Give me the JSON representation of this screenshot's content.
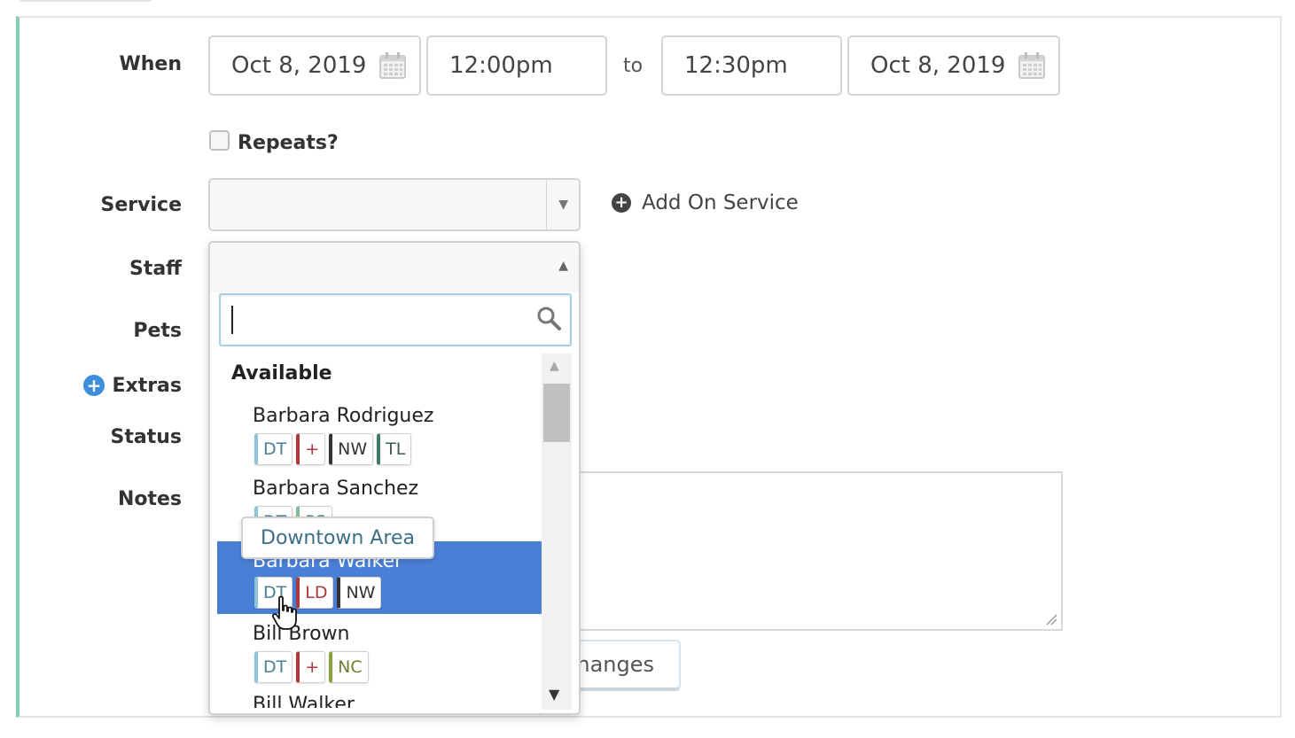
{
  "form": {
    "when_label": "When",
    "start_date": "Oct 8, 2019",
    "start_time": "12:00pm",
    "to_label": "to",
    "end_time": "12:30pm",
    "end_date": "Oct 8, 2019",
    "repeats_label": "Repeats?",
    "service_label": "Service",
    "service_value": "",
    "add_on_label": "Add On Service",
    "staff_label": "Staff",
    "pets_label": "Pets",
    "extras_label": "Extras",
    "status_label": "Status",
    "notes_label": "Notes",
    "save_button_label": "Changes"
  },
  "staff_dropdown": {
    "search_value": "",
    "group_label": "Available",
    "items": [
      {
        "name": "Barbara Rodriguez",
        "tags": [
          "DT",
          "+",
          "NW",
          "TL"
        ]
      },
      {
        "name": "Barbara Sanchez",
        "tags": [
          "DT",
          "PS"
        ]
      },
      {
        "name": "Barbara Walker",
        "tags": [
          "DT",
          "LD",
          "NW"
        ]
      },
      {
        "name": "Bill Brown",
        "tags": [
          "DT",
          "+",
          "NC"
        ]
      },
      {
        "name": "Bill Walker",
        "tags": []
      }
    ],
    "highlighted_index": 2
  },
  "tooltip": {
    "text": "Downtown Area"
  },
  "colors": {
    "accent_left_border": "#7fcfb0",
    "highlight": "#4a7fd6",
    "tag_DT": "#8ec4d8",
    "tag_plus": "#b03a3a",
    "tag_NW": "#333333",
    "tag_TL": "#3f7a6a",
    "tag_LD": "#b03a3a",
    "tag_NC": "#8aa43c",
    "tag_PS": "#7fbf9a"
  }
}
